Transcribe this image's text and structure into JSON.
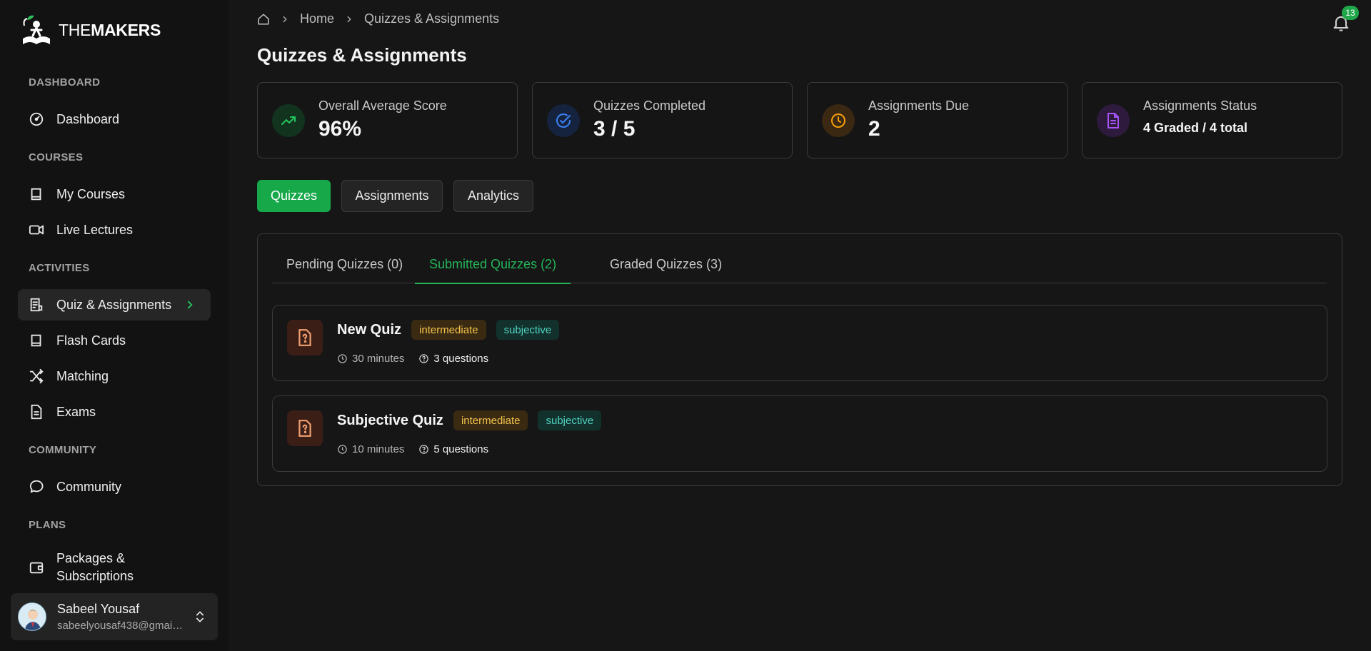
{
  "brand": {
    "name_light": "THE",
    "name_bold": "MAKERS"
  },
  "sidebar": {
    "sections": {
      "dashboard": "DASHBOARD",
      "courses": "COURSES",
      "activities": "ACTIVITIES",
      "community": "COMMUNITY",
      "plans": "PLANS"
    },
    "items": [
      {
        "label": "Dashboard",
        "icon": "gauge-icon"
      },
      {
        "label": "My Courses",
        "icon": "book-icon"
      },
      {
        "label": "Live Lectures",
        "icon": "video-icon"
      },
      {
        "label": "Quiz & Assignments",
        "icon": "clipboard-list-icon",
        "active": true
      },
      {
        "label": "Flash Cards",
        "icon": "book-icon"
      },
      {
        "label": "Matching",
        "icon": "shuffle-icon"
      },
      {
        "label": "Exams",
        "icon": "file-text-icon"
      },
      {
        "label": "Community",
        "icon": "message-circle-icon"
      },
      {
        "label": "Packages & Subscriptions",
        "icon": "wallet-icon"
      }
    ],
    "user": {
      "name": "Sabeel Yousaf",
      "email": "sabeelyousaf438@gmail.com"
    }
  },
  "breadcrumb": {
    "home": "Home",
    "current": "Quizzes & Assignments"
  },
  "notifications": {
    "count": "13"
  },
  "page": {
    "title": "Quizzes & Assignments"
  },
  "stats": [
    {
      "label": "Overall Average Score",
      "value": "96%",
      "icon": "trending-up-icon",
      "color": "#22c55e"
    },
    {
      "label": "Quizzes Completed",
      "value": "3 / 5",
      "icon": "check-circle-icon",
      "color": "#3b82f6"
    },
    {
      "label": "Assignments Due",
      "value": "2",
      "icon": "clock-icon",
      "color": "#f59e0b"
    },
    {
      "label": "Assignments Status",
      "value": "4 Graded / 4 total",
      "icon": "file-text-icon",
      "color": "#a855f7"
    }
  ],
  "main_tabs": [
    "Quizzes",
    "Assignments",
    "Analytics"
  ],
  "sub_tabs": [
    "Pending Quizzes (0)",
    "Submitted Quizzes (2)",
    "Graded Quizzes (3)"
  ],
  "quizzes": [
    {
      "title": "New Quiz",
      "level": "intermediate",
      "type": "subjective",
      "duration": "30 minutes",
      "questions": "3 questions"
    },
    {
      "title": "Subjective Quiz",
      "level": "intermediate",
      "type": "subjective",
      "duration": "10 minutes",
      "questions": "5 questions"
    }
  ],
  "colors": {
    "accent": "#17a84a",
    "background": "#161616",
    "sidebar": "#121212"
  }
}
